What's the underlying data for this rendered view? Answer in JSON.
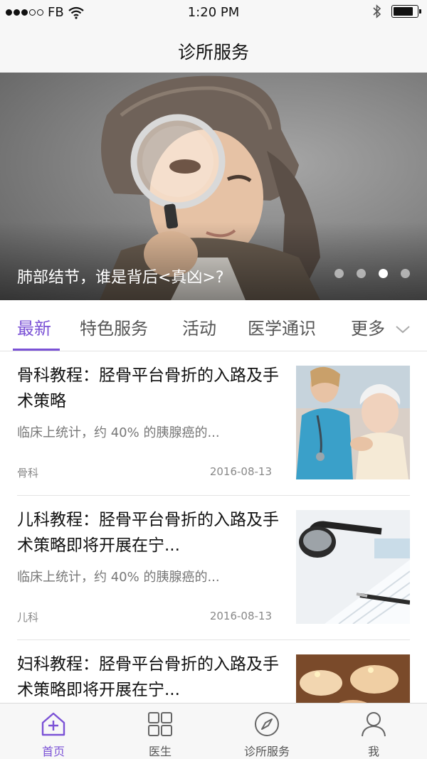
{
  "status_bar": {
    "carrier": "FB",
    "time": "1:20 PM",
    "battery_level": 0.85
  },
  "nav": {
    "title": "诊所服务"
  },
  "banner": {
    "caption": "肺部结节，谁是背后<真凶>?",
    "pages": 4,
    "active_page": 3
  },
  "tabs": [
    {
      "label": "最新",
      "active": true
    },
    {
      "label": "特色服务",
      "active": false
    },
    {
      "label": "活动",
      "active": false
    },
    {
      "label": "医学通识",
      "active": false
    },
    {
      "label": "更多",
      "active": false
    }
  ],
  "articles": [
    {
      "title": "骨科教程：胫骨平台骨折的入路及手术策略",
      "summary": "临床上统计，约 40% 的胰腺癌的...",
      "category": "骨科",
      "date": "2016-08-13",
      "thumb_icon": "nurse-elderly-photo"
    },
    {
      "title": "儿科教程：胫骨平台骨折的入路及手术策略即将开展在宁...",
      "summary": "临床上统计，约 40% 的胰腺癌的...",
      "category": "儿科",
      "date": "2016-08-13",
      "thumb_icon": "stethoscope-photo"
    },
    {
      "title": "妇科教程：胫骨平台骨折的入路及手术策略即将开展在宁...",
      "summary": "",
      "category": "",
      "date": "",
      "thumb_icon": "candles-photo"
    }
  ],
  "tabbar": [
    {
      "label": "首页",
      "icon": "home-icon",
      "active": true
    },
    {
      "label": "医生",
      "icon": "grid-icon",
      "active": false
    },
    {
      "label": "诊所服务",
      "icon": "compass-icon",
      "active": false
    },
    {
      "label": "我",
      "icon": "person-icon",
      "active": false
    }
  ],
  "colors": {
    "accent": "#7b52d6",
    "background": "#f7f7f7"
  }
}
